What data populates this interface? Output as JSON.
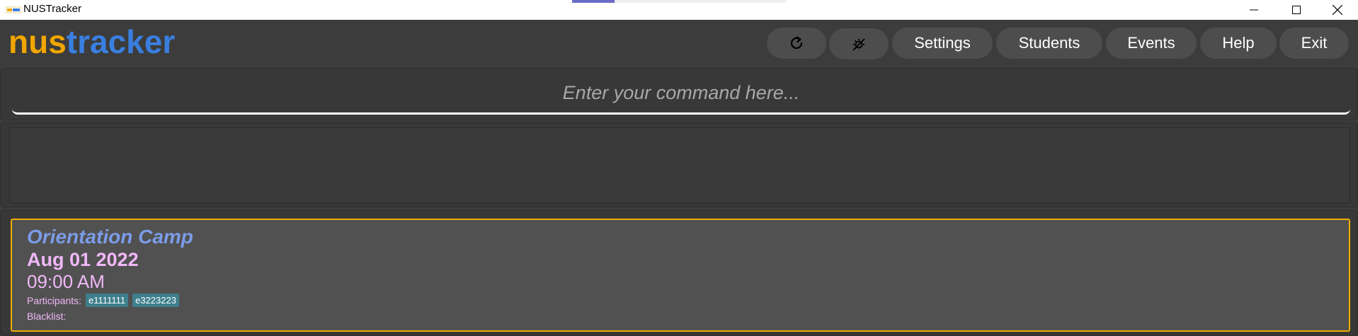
{
  "window": {
    "title": "NUSTracker",
    "controls": [
      "minimize-icon",
      "maximize-icon",
      "close-icon"
    ]
  },
  "header": {
    "logo_part1": "nus",
    "logo_part2": "tracker",
    "buttons": {
      "refresh_icon": "refresh-icon",
      "theme_icon": "theme-toggle-icon",
      "settings": "Settings",
      "students": "Students",
      "events": "Events",
      "help": "Help",
      "exit": "Exit"
    }
  },
  "command": {
    "placeholder": "Enter your command here...",
    "value": ""
  },
  "result": {
    "text": ""
  },
  "events": [
    {
      "name": "Orientation Camp",
      "date": "Aug 01 2022",
      "time": "09:00 AM",
      "participants_label": "Participants:",
      "participants": [
        "e1111111",
        "e3223223"
      ],
      "blacklist_label": "Blacklist:",
      "blacklist": []
    }
  ],
  "colors": {
    "background": "#3c3c3c",
    "logo_accent": "#f0a500",
    "logo_primary": "#3a7fe0",
    "card_border": "#f0b000",
    "event_name": "#7b9ce8",
    "event_text": "#f0b8f8",
    "tag": "#3e7f8d"
  }
}
